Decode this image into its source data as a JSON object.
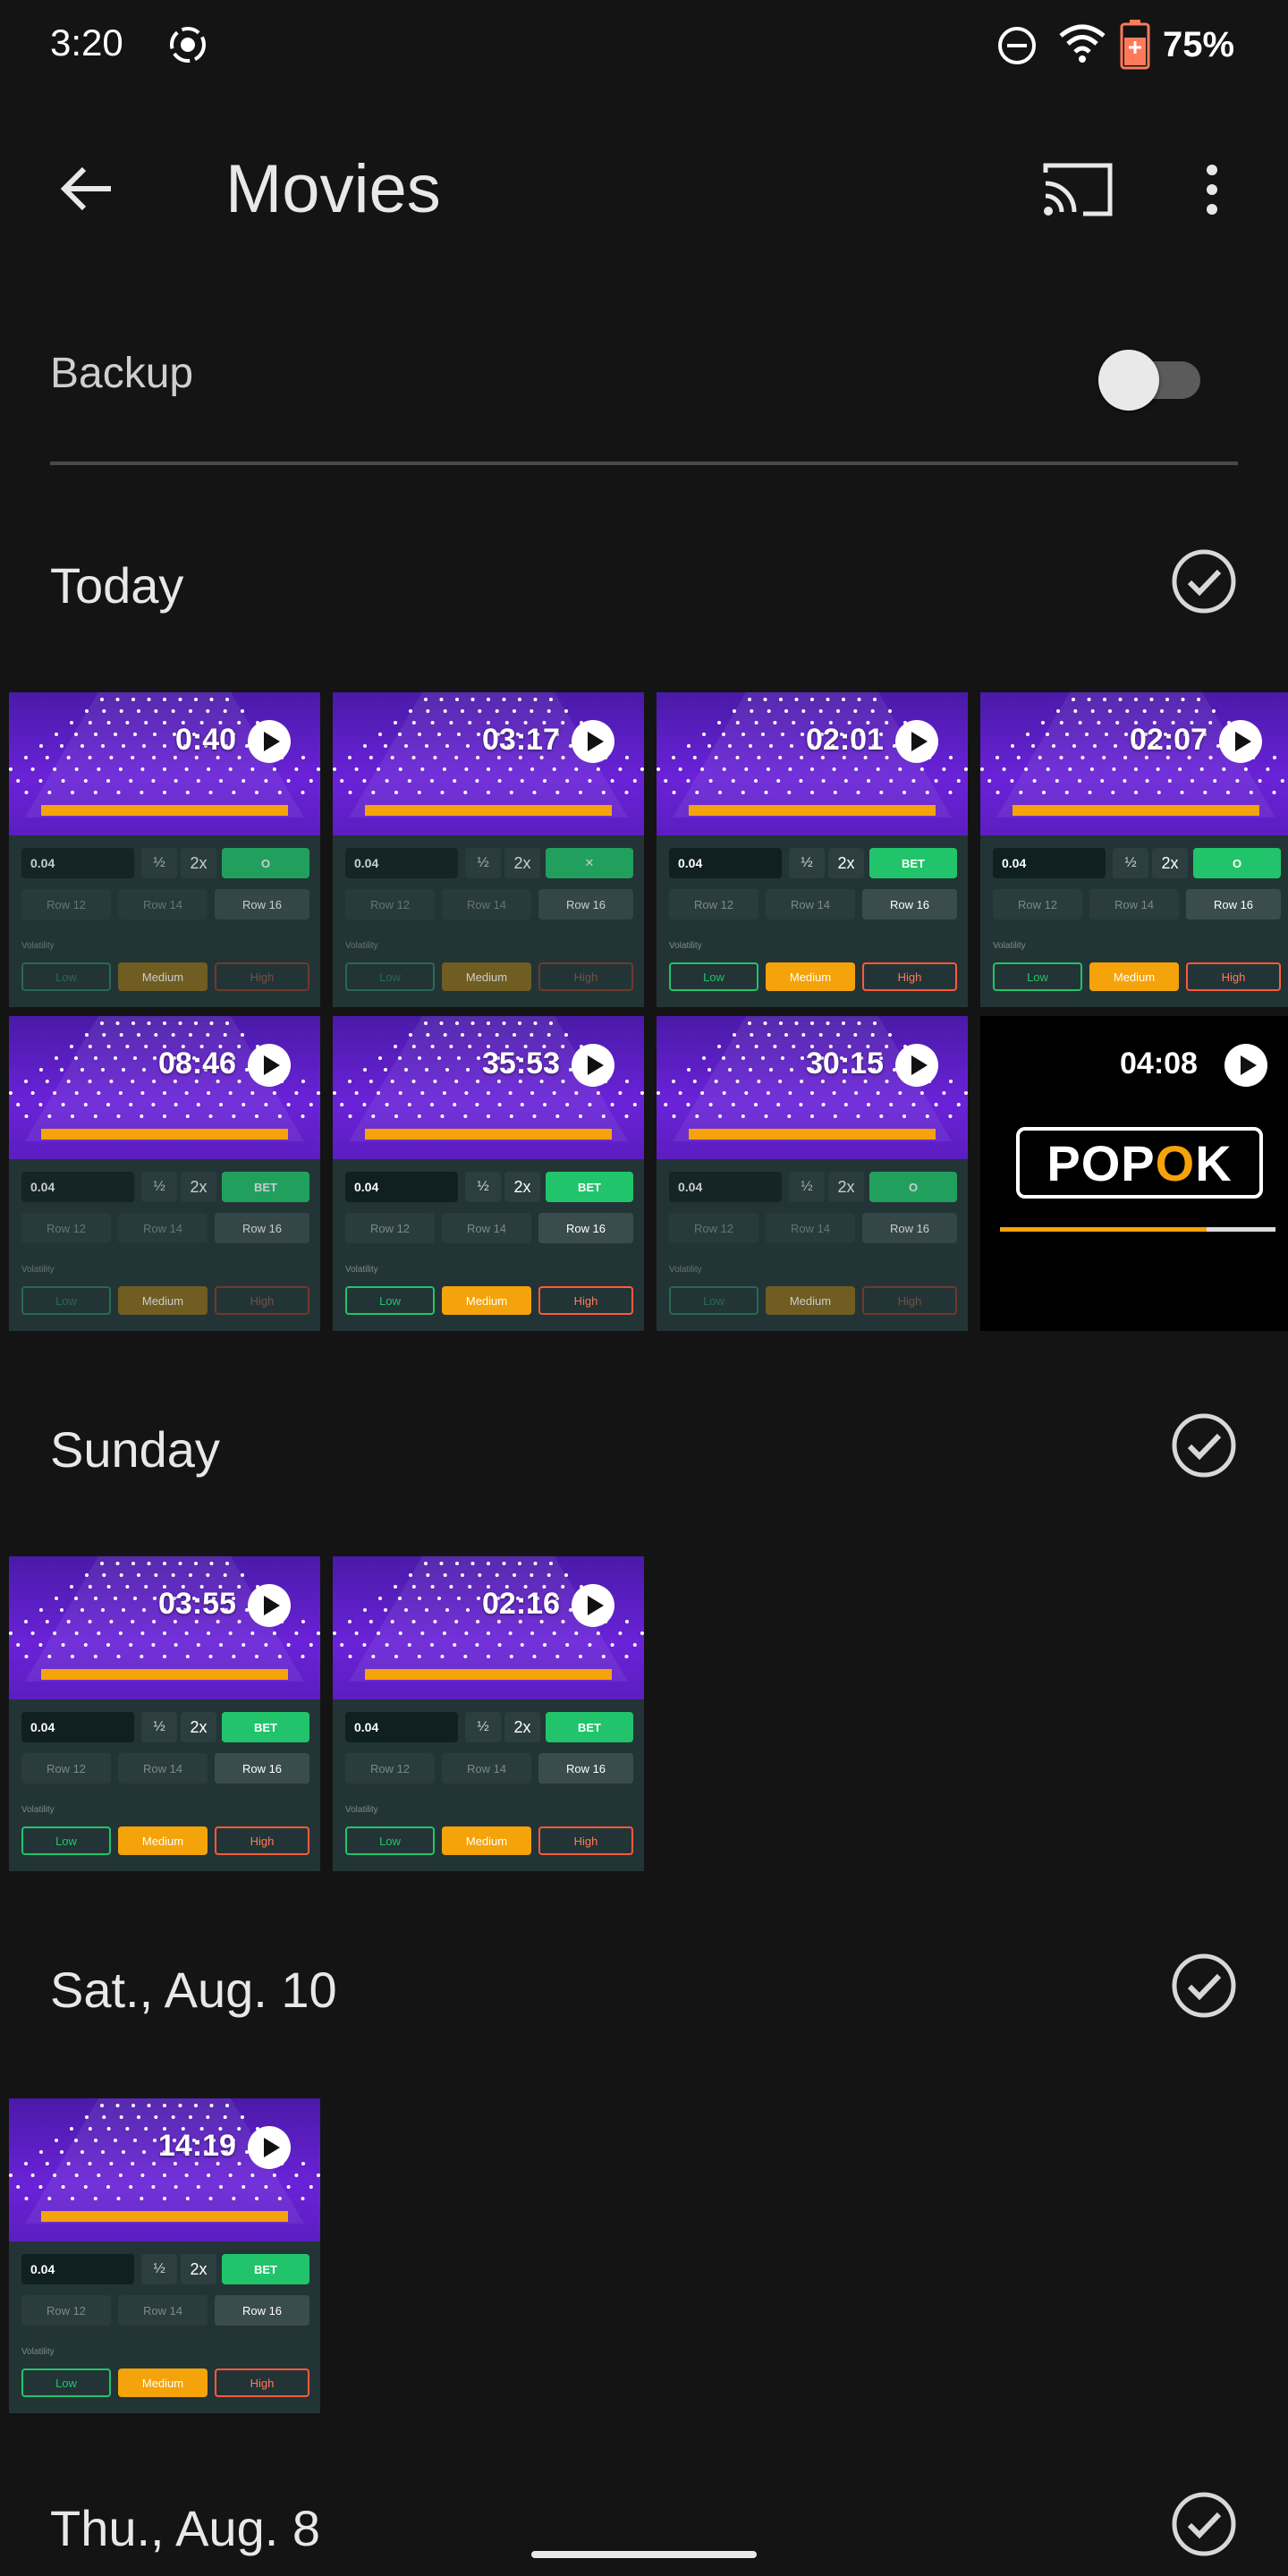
{
  "status": {
    "time": "3:20",
    "battery_pct": "75%"
  },
  "app_bar": {
    "title": "Movies"
  },
  "backup": {
    "label": "Backup",
    "enabled": false
  },
  "sections": [
    {
      "title": "Today",
      "videos": [
        {
          "duration": "0:40",
          "bet_label": "O",
          "dim": true
        },
        {
          "duration": "03:17",
          "bet_label": "✕",
          "dim": true
        },
        {
          "duration": "02:01",
          "bet_label": "BET",
          "dim": false
        },
        {
          "duration": "02:07",
          "bet_label": "O",
          "dim": false
        },
        {
          "duration": "08:46",
          "bet_label": "BET",
          "dim": true
        },
        {
          "duration": "35:53",
          "bet_label": "BET",
          "dim": false
        },
        {
          "duration": "30:15",
          "bet_label": "O",
          "dim": true
        },
        {
          "duration": "04:08",
          "type": "popok",
          "logo_text": "POPOK",
          "progress": 0.75
        }
      ]
    },
    {
      "title": "Sunday",
      "videos": [
        {
          "duration": "03:55",
          "bet_label": "BET",
          "dim": false
        },
        {
          "duration": "02:16",
          "bet_label": "BET",
          "dim": false
        }
      ]
    },
    {
      "title": "Sat., Aug. 10",
      "videos": [
        {
          "duration": "14:19",
          "bet_label": "BET",
          "dim": false
        }
      ]
    },
    {
      "title": "Thu., Aug. 8",
      "videos": []
    }
  ],
  "thumb_controls": {
    "amount": "0.04",
    "half": "½",
    "double": "2x",
    "row12": "Row 12",
    "row14": "Row 14",
    "row16": "Row 16",
    "volatility": "Volatility",
    "low": "Low",
    "medium": "Medium",
    "high": "High"
  },
  "colors": {
    "accent_green": "#21c46a",
    "accent_orange": "#f5a30a",
    "accent_red": "#ff5a3a",
    "plinko_purple": "#5b1ec0"
  }
}
